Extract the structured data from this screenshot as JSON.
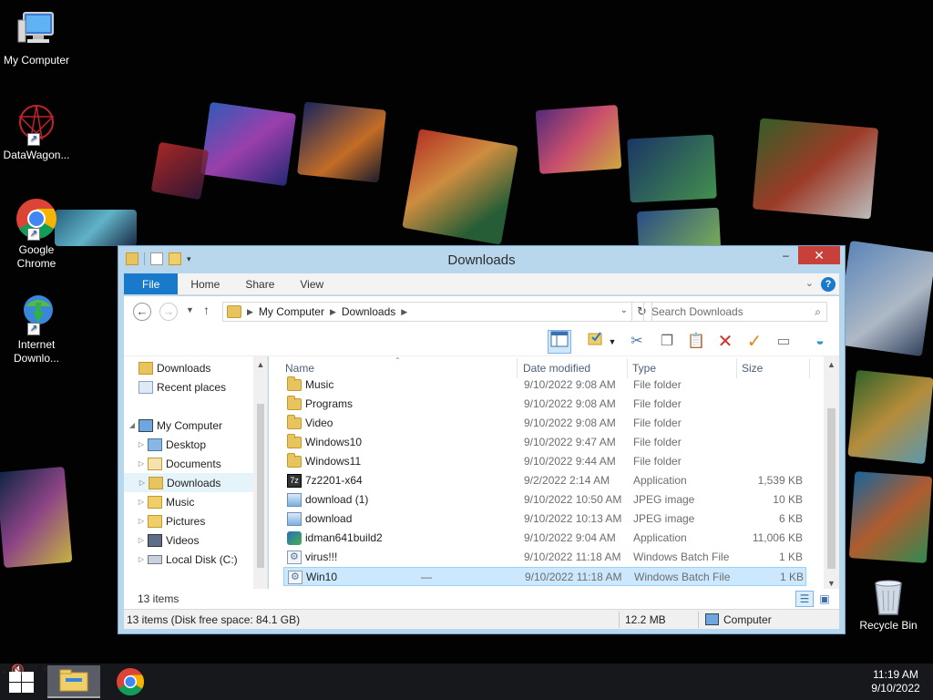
{
  "desktop": {
    "icons": [
      {
        "label": "My Computer"
      },
      {
        "label": "DataWagon..."
      },
      {
        "label": "Google Chrome"
      },
      {
        "label": "Internet Downlo..."
      },
      {
        "label": "Recycle Bin"
      }
    ]
  },
  "window": {
    "title": "Downloads",
    "controls": {
      "minimize": "–",
      "maximize": "☐",
      "close": "✕"
    },
    "ribbon": {
      "tabs": [
        "File",
        "Home",
        "Share",
        "View"
      ],
      "help": "?"
    },
    "address": {
      "crumbs": [
        "My Computer",
        "Downloads"
      ],
      "search_placeholder": "Search Downloads"
    },
    "nav": {
      "quick": [
        "Downloads",
        "Recent places"
      ],
      "root": "My Computer",
      "children": [
        "Desktop",
        "Documents",
        "Downloads",
        "Music",
        "Pictures",
        "Videos",
        "Local Disk (C:)"
      ],
      "selected": "Downloads"
    },
    "columns": {
      "name": "Name",
      "date": "Date modified",
      "type": "Type",
      "size": "Size"
    },
    "files": [
      {
        "name": "Music",
        "date": "9/10/2022 9:08 AM",
        "type": "File folder",
        "size": "",
        "icon": "folder"
      },
      {
        "name": "Programs",
        "date": "9/10/2022 9:08 AM",
        "type": "File folder",
        "size": "",
        "icon": "folder"
      },
      {
        "name": "Video",
        "date": "9/10/2022 9:08 AM",
        "type": "File folder",
        "size": "",
        "icon": "folder"
      },
      {
        "name": "Windows10",
        "date": "9/10/2022 9:47 AM",
        "type": "File folder",
        "size": "",
        "icon": "folder"
      },
      {
        "name": "Windows11",
        "date": "9/10/2022 9:44 AM",
        "type": "File folder",
        "size": "",
        "icon": "folder"
      },
      {
        "name": "7z2201-x64",
        "date": "9/2/2022 2:14 AM",
        "type": "Application",
        "size": "1,539 KB",
        "icon": "app"
      },
      {
        "name": "download (1)",
        "date": "9/10/2022 10:50 AM",
        "type": "JPEG image",
        "size": "10 KB",
        "icon": "jpeg"
      },
      {
        "name": "download",
        "date": "9/10/2022 10:13 AM",
        "type": "JPEG image",
        "size": "6 KB",
        "icon": "jpeg"
      },
      {
        "name": "idman641build2",
        "date": "9/10/2022 9:04 AM",
        "type": "Application",
        "size": "11,006 KB",
        "icon": "idm"
      },
      {
        "name": "virus!!!",
        "date": "9/10/2022 11:18 AM",
        "type": "Windows Batch File",
        "size": "1 KB",
        "icon": "bat"
      },
      {
        "name": "Win10",
        "date": "9/10/2022 11:18 AM",
        "type": "Windows Batch File",
        "size": "1 KB",
        "icon": "bat"
      }
    ],
    "selected_file": "Win10",
    "rename_dash": "—",
    "items_count": "13 items",
    "status": {
      "left": "13 items (Disk free space: 84.1 GB)",
      "size": "12.2 MB",
      "location": "Computer"
    }
  },
  "taskbar": {
    "time": "11:19 AM",
    "date": "9/10/2022",
    "tray_up": "▲"
  }
}
